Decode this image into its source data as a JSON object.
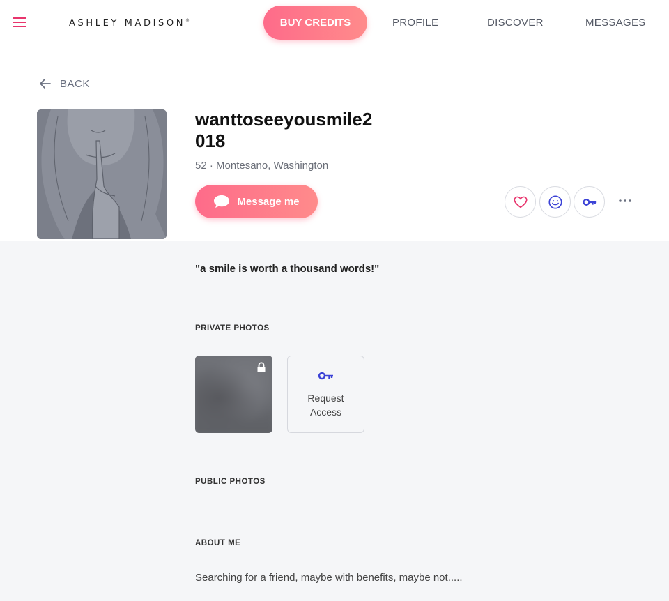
{
  "header": {
    "logo": "ASHLEY MADISON",
    "logo_mark": "®",
    "buy_credits": "BUY CREDITS",
    "nav": [
      "PROFILE",
      "DISCOVER",
      "MESSAGES"
    ]
  },
  "back_label": "BACK",
  "profile": {
    "username_line1": "wanttoseeyousmile2",
    "username_line2": "018",
    "location": "52 · Montesano, Washington",
    "message_button": "Message me",
    "tagline": "\"a smile is worth a thousand words!\""
  },
  "sections": {
    "private_photos": "PRIVATE PHOTOS",
    "request_access": "Request Access",
    "public_photos": "PUBLIC PHOTOS",
    "about_me": "ABOUT ME",
    "about_text": "Searching for a friend, maybe with benefits, maybe not....."
  },
  "colors": {
    "accent": "#fe6b8a",
    "key_blue": "#3b42d6",
    "heart_pink": "#e8356d"
  }
}
